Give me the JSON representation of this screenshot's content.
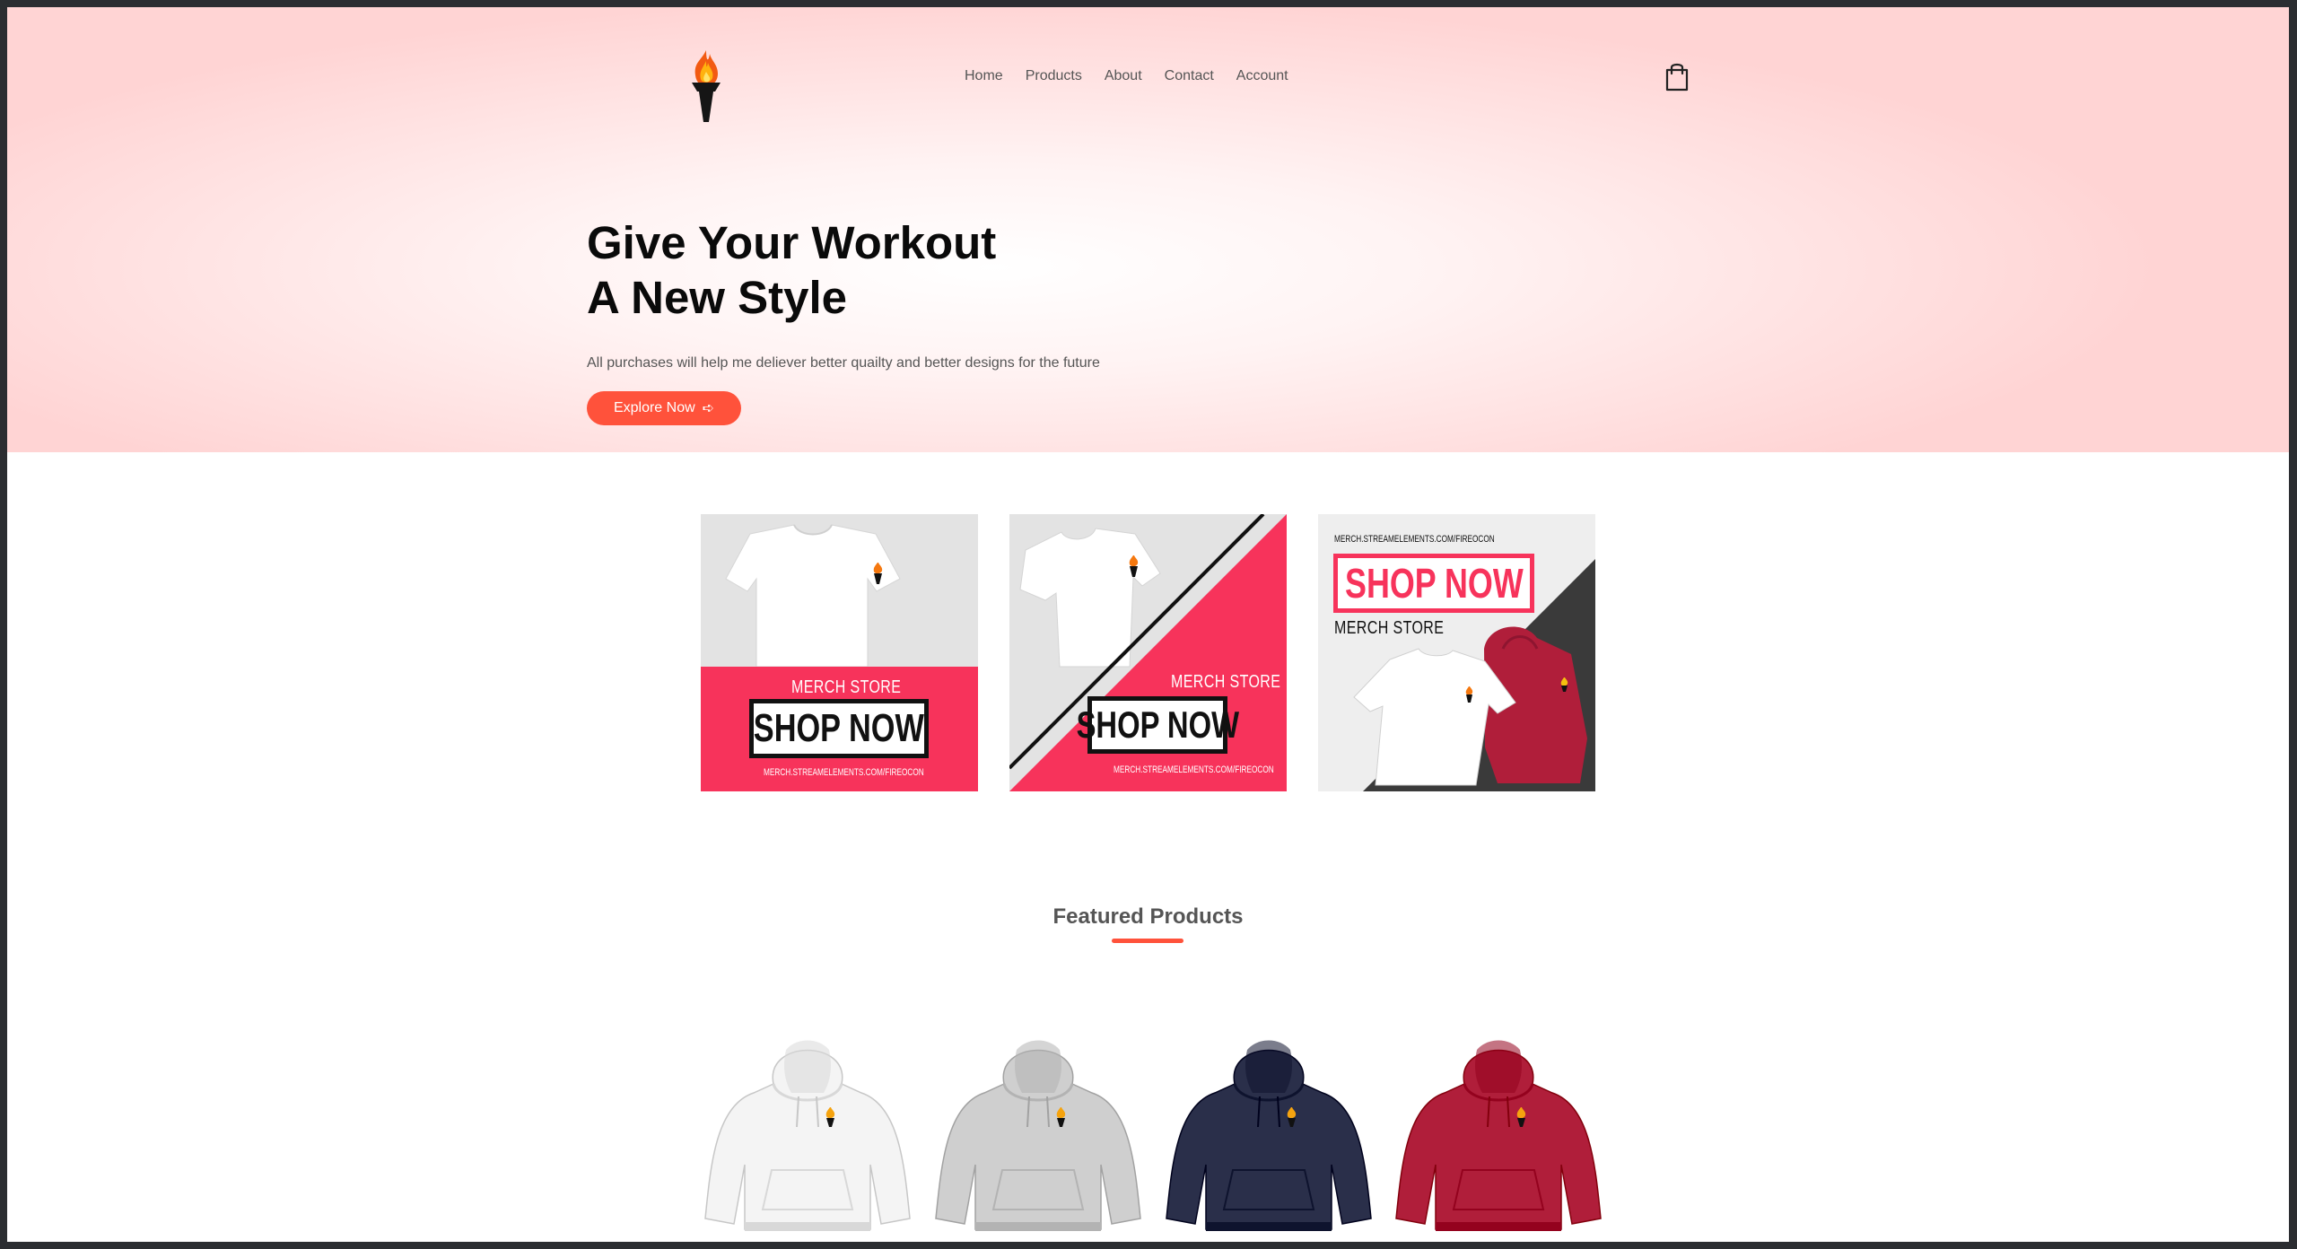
{
  "nav": {
    "items": [
      "Home",
      "Products",
      "About",
      "Contact",
      "Account"
    ]
  },
  "hero": {
    "headline_line1": "Give Your Workout",
    "headline_line2": "A New Style",
    "subtitle": "All purchases will help me deliever better quailty and better designs for the future",
    "cta_label": "Explore Now",
    "cta_arrow": "➪"
  },
  "banners": [
    {
      "merch_label": "MERCH STORE",
      "shop_label": "SHOP NOW",
      "url": "MERCH.STREAMELEMENTS.COM/FIREOCON"
    },
    {
      "merch_label": "MERCH STORE",
      "shop_label": "SHOP NOW",
      "url": "MERCH.STREAMELEMENTS.COM/FIREOCON"
    },
    {
      "merch_label": "MERCH STORE",
      "shop_label": "SHOP NOW",
      "url": "MERCH.STREAMELEMENTS.COM/FIREOCON"
    }
  ],
  "featured": {
    "title": "Featured Products",
    "products": [
      {
        "color_name": "white",
        "color": "#f4f4f4"
      },
      {
        "color_name": "heather-grey",
        "color": "#cfcfcf"
      },
      {
        "color_name": "navy",
        "color": "#2a2f4a"
      },
      {
        "color_name": "maroon",
        "color": "#b01e3a"
      }
    ]
  },
  "colors": {
    "accent": "#ff523b",
    "banner_pink": "#f7335b",
    "hero_pink": "#ffd6d6"
  },
  "icons": [
    "torch-logo-icon",
    "shopping-bag-icon",
    "arrow-icon"
  ]
}
